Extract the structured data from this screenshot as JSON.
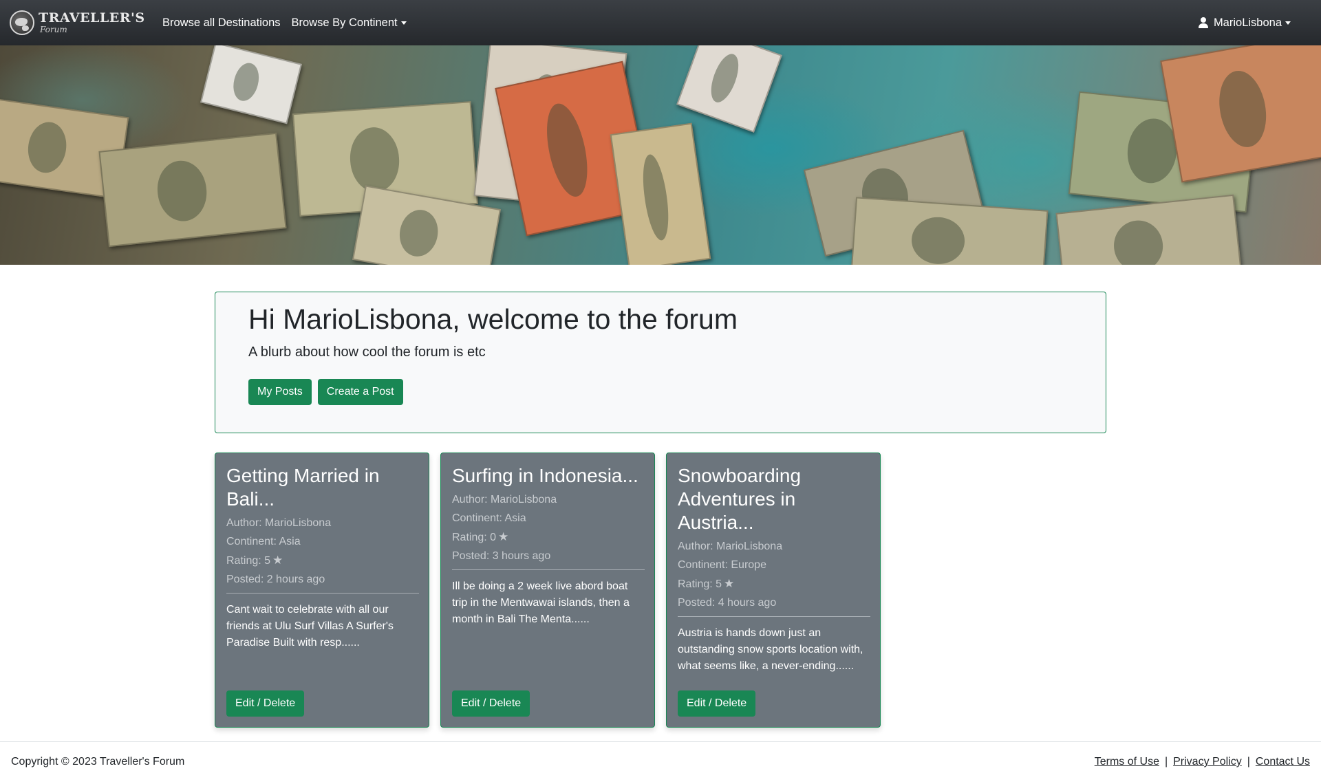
{
  "navbar": {
    "brand_name": "TRAVELLER'S",
    "brand_sub": "Forum",
    "links": [
      {
        "label": "Browse all Destinations"
      },
      {
        "label": "Browse By Continent"
      }
    ],
    "user": "MarioLisbona"
  },
  "hero": {
    "description_icon": "banknotes-on-world-map-image"
  },
  "jumbotron": {
    "title": "Hi MarioLisbona, welcome to the forum",
    "blurb": "A blurb about how cool the forum is etc",
    "buttons": {
      "my_posts": "My Posts",
      "create_post": "Create a Post"
    }
  },
  "posts": [
    {
      "title": "Getting Married in Bali...",
      "author": "Author: MarioLisbona",
      "continent": "Continent: Asia",
      "rating": "Rating: 5",
      "posted": "Posted: 2 hours ago",
      "excerpt": "Cant wait to celebrate with all our friends at Ulu Surf Villas A Surfer's Paradise Built with resp......",
      "button": "Edit / Delete"
    },
    {
      "title": "Surfing in Indonesia...",
      "author": "Author: MarioLisbona",
      "continent": "Continent: Asia",
      "rating": "Rating: 0",
      "posted": "Posted: 3 hours ago",
      "excerpt": "Ill be doing a 2 week live abord boat trip in the Mentwawai islands, then a month in Bali The Menta......",
      "button": "Edit / Delete"
    },
    {
      "title": "Snowboarding Adventures in Austria...",
      "author": "Author: MarioLisbona",
      "continent": "Continent: Europe",
      "rating": "Rating: 5",
      "posted": "Posted: 4 hours ago",
      "excerpt": "Austria is hands down just an outstanding snow sports location with, what seems like, a never-ending......",
      "button": "Edit / Delete"
    }
  ],
  "footer": {
    "copyright": "Copyright © 2023 Traveller's Forum",
    "links": [
      "Terms of Use",
      "Privacy Policy",
      "Contact Us"
    ],
    "separator": "|"
  },
  "colors": {
    "navbar": "#2b2f33",
    "accent_green": "#198754",
    "card_bg": "#6c757d",
    "jumbotron_bg": "#f8f9fa"
  }
}
